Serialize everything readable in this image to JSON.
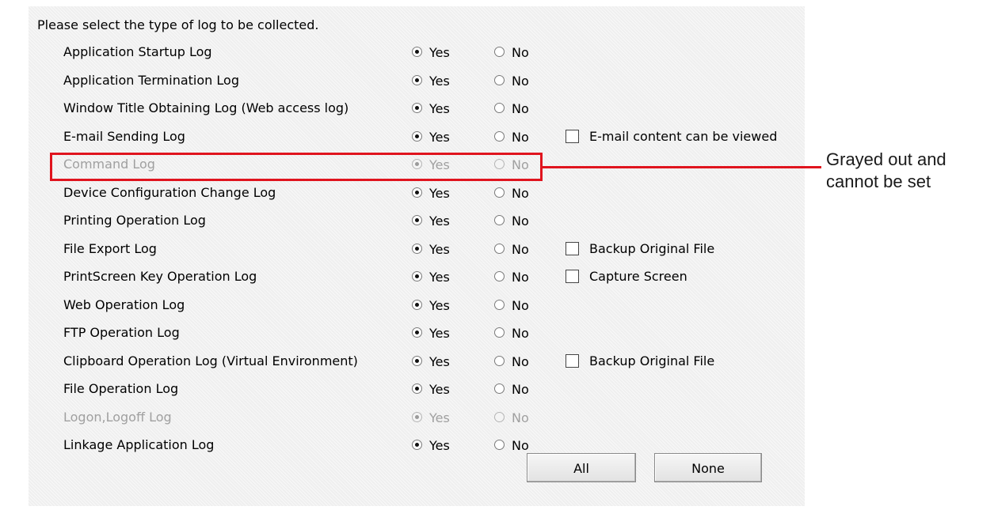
{
  "intro": "Please select the type of log to be collected.",
  "yes_label": "Yes",
  "no_label": "No",
  "rows": [
    {
      "label": "Application Startup Log",
      "selected": "Yes",
      "disabled": false,
      "extra": null
    },
    {
      "label": "Application Termination Log",
      "selected": "Yes",
      "disabled": false,
      "extra": null
    },
    {
      "label": "Window Title Obtaining Log (Web access log)",
      "selected": "Yes",
      "disabled": false,
      "extra": null
    },
    {
      "label": "E-mail Sending Log",
      "selected": "Yes",
      "disabled": false,
      "extra": {
        "label": "E-mail content can be viewed",
        "checked": false
      }
    },
    {
      "label": "Command Log",
      "selected": "Yes",
      "disabled": true,
      "extra": null
    },
    {
      "label": "Device Configuration Change Log",
      "selected": "Yes",
      "disabled": false,
      "extra": null
    },
    {
      "label": "Printing Operation Log",
      "selected": "Yes",
      "disabled": false,
      "extra": null
    },
    {
      "label": "File Export Log",
      "selected": "Yes",
      "disabled": false,
      "extra": {
        "label": "Backup Original File",
        "checked": false
      }
    },
    {
      "label": "PrintScreen Key Operation Log",
      "selected": "Yes",
      "disabled": false,
      "extra": {
        "label": "Capture Screen",
        "checked": false
      }
    },
    {
      "label": "Web Operation Log",
      "selected": "Yes",
      "disabled": false,
      "extra": null
    },
    {
      "label": "FTP Operation Log",
      "selected": "Yes",
      "disabled": false,
      "extra": null
    },
    {
      "label": "Clipboard Operation Log (Virtual Environment)",
      "selected": "Yes",
      "disabled": false,
      "extra": {
        "label": "Backup Original File",
        "checked": false
      }
    },
    {
      "label": "File Operation Log",
      "selected": "Yes",
      "disabled": false,
      "extra": null
    },
    {
      "label": "Logon,Logoff Log",
      "selected": "Yes",
      "disabled": true,
      "extra": null
    },
    {
      "label": "Linkage Application Log",
      "selected": "Yes",
      "disabled": false,
      "extra": null
    }
  ],
  "buttons": {
    "all": "All",
    "none": "None"
  },
  "callout": {
    "text": "Grayed out and cannot be set",
    "color": "#e0141e"
  }
}
